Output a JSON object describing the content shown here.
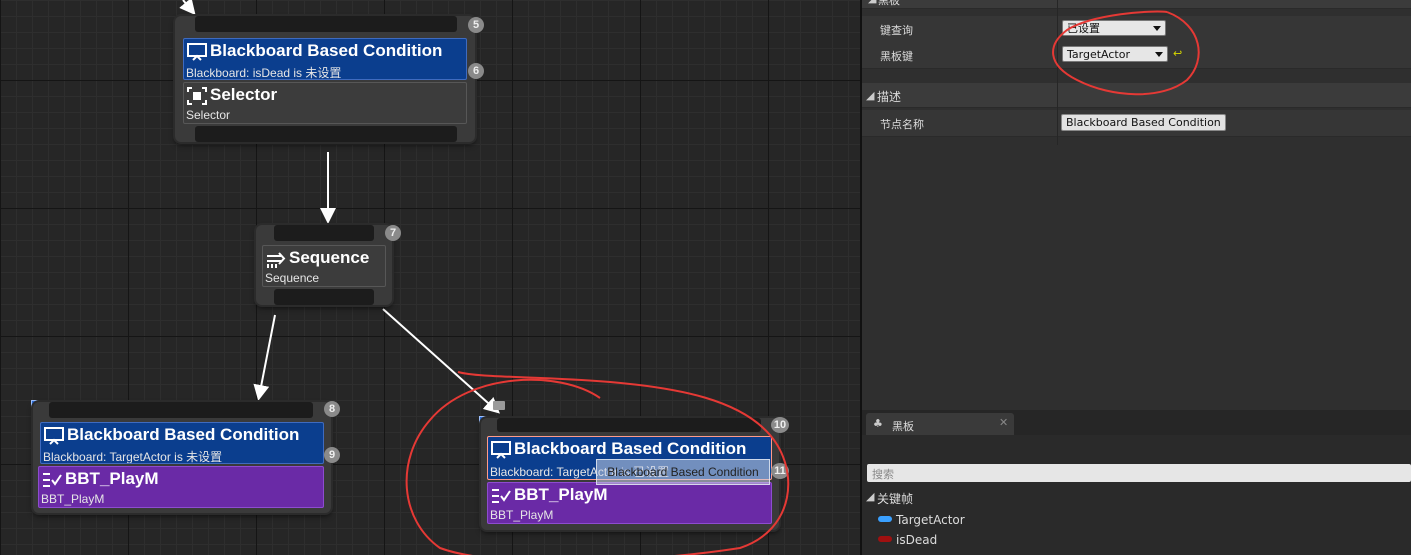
{
  "graph": {
    "nodes": [
      {
        "badge": "5",
        "decorator": {
          "title": "Blackboard Based Condition",
          "sub": "Blackboard: isDead is 未设置",
          "badge": "6"
        },
        "main": {
          "title": "Selector",
          "sub": "Selector"
        }
      },
      {
        "badge": "7",
        "main": {
          "title": "Sequence",
          "sub": "Sequence"
        }
      },
      {
        "badge": "8",
        "decorator": {
          "title": "Blackboard Based Condition",
          "sub": "Blackboard: TargetActor is 未设置",
          "badge": "9"
        },
        "main": {
          "title": "BBT_PlayM",
          "sub": "BBT_PlayM"
        }
      },
      {
        "badge": "10",
        "decorator": {
          "title": "Blackboard Based Condition",
          "sub": "Blackboard: TargetActor is 已设置",
          "badge": "11"
        },
        "main": {
          "title": "BBT_PlayM",
          "sub": "BBT_PlayM"
        },
        "drag_tooltip": "Blackboard Based Condition"
      }
    ]
  },
  "details": {
    "section_blackboard": "黑板",
    "key_query_label": "键查询",
    "key_query_value": "已设置",
    "bb_key_label": "黑板键",
    "bb_key_value": "TargetActor",
    "section_desc": "描述",
    "node_name_label": "节点名称",
    "node_name_value": "Blackboard Based Condition"
  },
  "blackboard_panel": {
    "tab_label": "黑板",
    "search_placeholder": "搜索",
    "keys_section": "关键帧",
    "keys": [
      {
        "name": "TargetActor",
        "color": "#3aa0ff"
      },
      {
        "name": "isDead",
        "color": "#a01010"
      }
    ]
  },
  "colors": {
    "annotation": "#e53935",
    "decorator": "#0b3e8e",
    "task": "#6a2aa6"
  }
}
